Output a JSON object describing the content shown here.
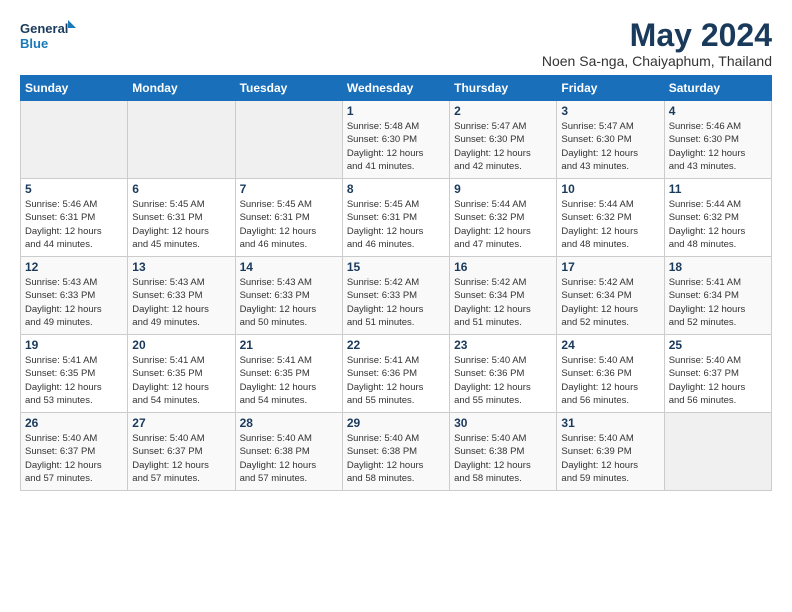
{
  "header": {
    "logo_line1": "General",
    "logo_line2": "Blue",
    "title": "May 2024",
    "subtitle": "Noen Sa-nga, Chaiyaphum, Thailand"
  },
  "weekdays": [
    "Sunday",
    "Monday",
    "Tuesday",
    "Wednesday",
    "Thursday",
    "Friday",
    "Saturday"
  ],
  "weeks": [
    [
      {
        "day": "",
        "info": ""
      },
      {
        "day": "",
        "info": ""
      },
      {
        "day": "",
        "info": ""
      },
      {
        "day": "1",
        "info": "Sunrise: 5:48 AM\nSunset: 6:30 PM\nDaylight: 12 hours\nand 41 minutes."
      },
      {
        "day": "2",
        "info": "Sunrise: 5:47 AM\nSunset: 6:30 PM\nDaylight: 12 hours\nand 42 minutes."
      },
      {
        "day": "3",
        "info": "Sunrise: 5:47 AM\nSunset: 6:30 PM\nDaylight: 12 hours\nand 43 minutes."
      },
      {
        "day": "4",
        "info": "Sunrise: 5:46 AM\nSunset: 6:30 PM\nDaylight: 12 hours\nand 43 minutes."
      }
    ],
    [
      {
        "day": "5",
        "info": "Sunrise: 5:46 AM\nSunset: 6:31 PM\nDaylight: 12 hours\nand 44 minutes."
      },
      {
        "day": "6",
        "info": "Sunrise: 5:45 AM\nSunset: 6:31 PM\nDaylight: 12 hours\nand 45 minutes."
      },
      {
        "day": "7",
        "info": "Sunrise: 5:45 AM\nSunset: 6:31 PM\nDaylight: 12 hours\nand 46 minutes."
      },
      {
        "day": "8",
        "info": "Sunrise: 5:45 AM\nSunset: 6:31 PM\nDaylight: 12 hours\nand 46 minutes."
      },
      {
        "day": "9",
        "info": "Sunrise: 5:44 AM\nSunset: 6:32 PM\nDaylight: 12 hours\nand 47 minutes."
      },
      {
        "day": "10",
        "info": "Sunrise: 5:44 AM\nSunset: 6:32 PM\nDaylight: 12 hours\nand 48 minutes."
      },
      {
        "day": "11",
        "info": "Sunrise: 5:44 AM\nSunset: 6:32 PM\nDaylight: 12 hours\nand 48 minutes."
      }
    ],
    [
      {
        "day": "12",
        "info": "Sunrise: 5:43 AM\nSunset: 6:33 PM\nDaylight: 12 hours\nand 49 minutes."
      },
      {
        "day": "13",
        "info": "Sunrise: 5:43 AM\nSunset: 6:33 PM\nDaylight: 12 hours\nand 49 minutes."
      },
      {
        "day": "14",
        "info": "Sunrise: 5:43 AM\nSunset: 6:33 PM\nDaylight: 12 hours\nand 50 minutes."
      },
      {
        "day": "15",
        "info": "Sunrise: 5:42 AM\nSunset: 6:33 PM\nDaylight: 12 hours\nand 51 minutes."
      },
      {
        "day": "16",
        "info": "Sunrise: 5:42 AM\nSunset: 6:34 PM\nDaylight: 12 hours\nand 51 minutes."
      },
      {
        "day": "17",
        "info": "Sunrise: 5:42 AM\nSunset: 6:34 PM\nDaylight: 12 hours\nand 52 minutes."
      },
      {
        "day": "18",
        "info": "Sunrise: 5:41 AM\nSunset: 6:34 PM\nDaylight: 12 hours\nand 52 minutes."
      }
    ],
    [
      {
        "day": "19",
        "info": "Sunrise: 5:41 AM\nSunset: 6:35 PM\nDaylight: 12 hours\nand 53 minutes."
      },
      {
        "day": "20",
        "info": "Sunrise: 5:41 AM\nSunset: 6:35 PM\nDaylight: 12 hours\nand 54 minutes."
      },
      {
        "day": "21",
        "info": "Sunrise: 5:41 AM\nSunset: 6:35 PM\nDaylight: 12 hours\nand 54 minutes."
      },
      {
        "day": "22",
        "info": "Sunrise: 5:41 AM\nSunset: 6:36 PM\nDaylight: 12 hours\nand 55 minutes."
      },
      {
        "day": "23",
        "info": "Sunrise: 5:40 AM\nSunset: 6:36 PM\nDaylight: 12 hours\nand 55 minutes."
      },
      {
        "day": "24",
        "info": "Sunrise: 5:40 AM\nSunset: 6:36 PM\nDaylight: 12 hours\nand 56 minutes."
      },
      {
        "day": "25",
        "info": "Sunrise: 5:40 AM\nSunset: 6:37 PM\nDaylight: 12 hours\nand 56 minutes."
      }
    ],
    [
      {
        "day": "26",
        "info": "Sunrise: 5:40 AM\nSunset: 6:37 PM\nDaylight: 12 hours\nand 57 minutes."
      },
      {
        "day": "27",
        "info": "Sunrise: 5:40 AM\nSunset: 6:37 PM\nDaylight: 12 hours\nand 57 minutes."
      },
      {
        "day": "28",
        "info": "Sunrise: 5:40 AM\nSunset: 6:38 PM\nDaylight: 12 hours\nand 57 minutes."
      },
      {
        "day": "29",
        "info": "Sunrise: 5:40 AM\nSunset: 6:38 PM\nDaylight: 12 hours\nand 58 minutes."
      },
      {
        "day": "30",
        "info": "Sunrise: 5:40 AM\nSunset: 6:38 PM\nDaylight: 12 hours\nand 58 minutes."
      },
      {
        "day": "31",
        "info": "Sunrise: 5:40 AM\nSunset: 6:39 PM\nDaylight: 12 hours\nand 59 minutes."
      },
      {
        "day": "",
        "info": ""
      }
    ]
  ]
}
